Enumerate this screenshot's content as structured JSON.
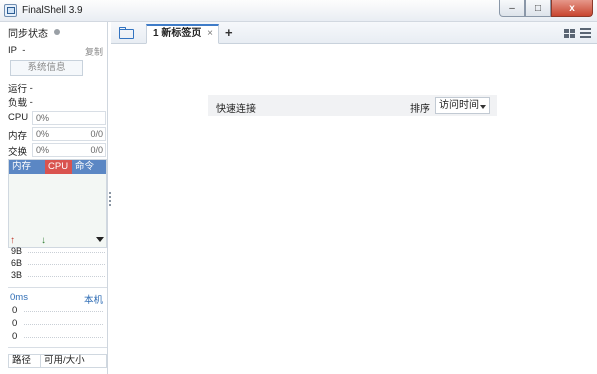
{
  "window": {
    "title": "FinalShell 3.9",
    "buttons": {
      "minimize": "–",
      "maximize": "□",
      "close": "x"
    }
  },
  "sidebar": {
    "sync_label": "同步状态",
    "ip_label": "IP",
    "ip_value": "-",
    "copy_label": "复制",
    "sysinfo_button": "系统信息",
    "run_label": "运行",
    "run_value": "-",
    "load_label": "负载",
    "load_value": "-",
    "cpu": {
      "label": "CPU",
      "percent": "0%"
    },
    "mem": {
      "label": "内存",
      "percent": "0%",
      "ratio": "0/0"
    },
    "swap": {
      "label": "交换",
      "percent": "0%",
      "ratio": "0/0"
    },
    "proc_cols": [
      "内存",
      "CPU",
      "命令"
    ],
    "net_ticks": [
      "9B",
      "6B",
      "3B"
    ],
    "latency": {
      "ms": "0ms",
      "host": "本机",
      "values": [
        "0",
        "0",
        "0"
      ]
    },
    "disk_cols": [
      "路径",
      "可用/大小"
    ]
  },
  "tabs": [
    {
      "label": "1 新标签页",
      "close": "×"
    }
  ],
  "add_tab": "+",
  "quick_connect": {
    "title": "快速连接",
    "sort_label": "排序",
    "sort_value": "访问时间"
  },
  "colors": {
    "accent": "#3f7cc8",
    "proc_header": "#5b87c4",
    "cpu_highlight": "#d9534f"
  }
}
